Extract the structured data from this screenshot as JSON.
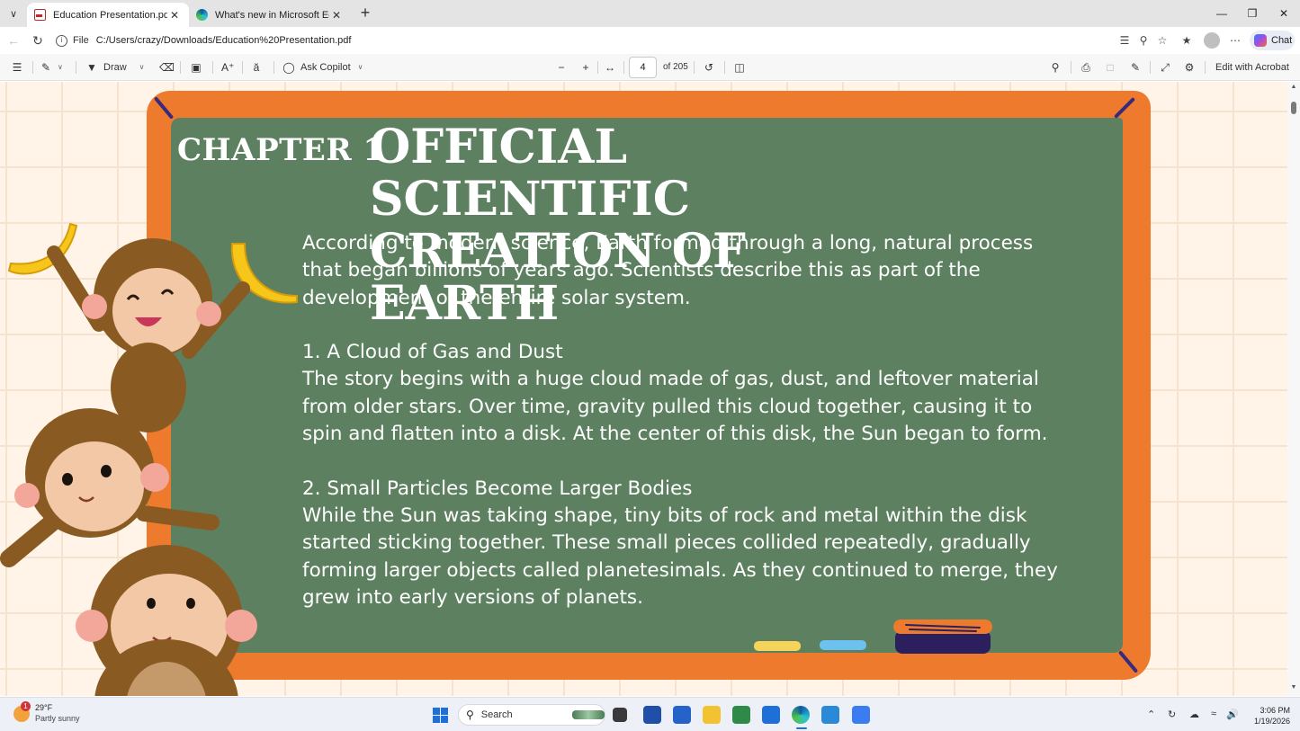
{
  "browser": {
    "tabs": [
      {
        "title": "Education Presentation.pdf",
        "active": true,
        "icon": "pdf-icon"
      },
      {
        "title": "What's new in Microsoft Edge",
        "active": false,
        "icon": "edge-icon"
      }
    ],
    "address": {
      "scheme": "File",
      "url": "C:/Users/crazy/Downloads/Education%20Presentation.pdf"
    },
    "chat_label": "Chat"
  },
  "pdf_toolbar": {
    "draw_label": "Draw",
    "ask_copilot_label": "Ask Copilot",
    "page_number": "4",
    "page_total": "of 205",
    "edit_acrobat_label": "Edit with Acrobat"
  },
  "slide": {
    "chapter": "CHAPTER 1",
    "title_line1": "OFFICIAL SCIENTIFIC",
    "title_line2": "CREATION OF EARTH",
    "paragraphs": [
      "According to modern science, Earth formed through a long, natural process",
      "that began billions of years ago. Scientists describe this as part of the",
      "development of the entire solar system."
    ],
    "section1_heading": "1. A Cloud of Gas and Dust",
    "section1_lines": [
      "The story begins with a huge cloud made of gas, dust, and leftover material",
      "from older stars. Over time, gravity pulled this cloud together, causing it to",
      "spin and flatten into a disk. At the center of this disk, the Sun began to form."
    ],
    "section2_heading": "2. Small Particles Become Larger Bodies",
    "section2_lines": [
      "While the Sun was taking shape, tiny bits of rock and metal within the disk",
      "started sticking together. These small pieces collided repeatedly, gradually",
      "forming larger objects called planetesimals. As they continued to merge, they",
      "grew into early versions of planets."
    ],
    "colors": {
      "board": "#5d8160",
      "frame": "#ee7b2d",
      "background": "#fff4e7"
    }
  },
  "taskbar": {
    "weather_badge": "1",
    "weather_temp": "29°F",
    "weather_desc": "Partly sunny",
    "search_label": "Search",
    "time": "3:06 PM",
    "date": "1/19/2026"
  }
}
